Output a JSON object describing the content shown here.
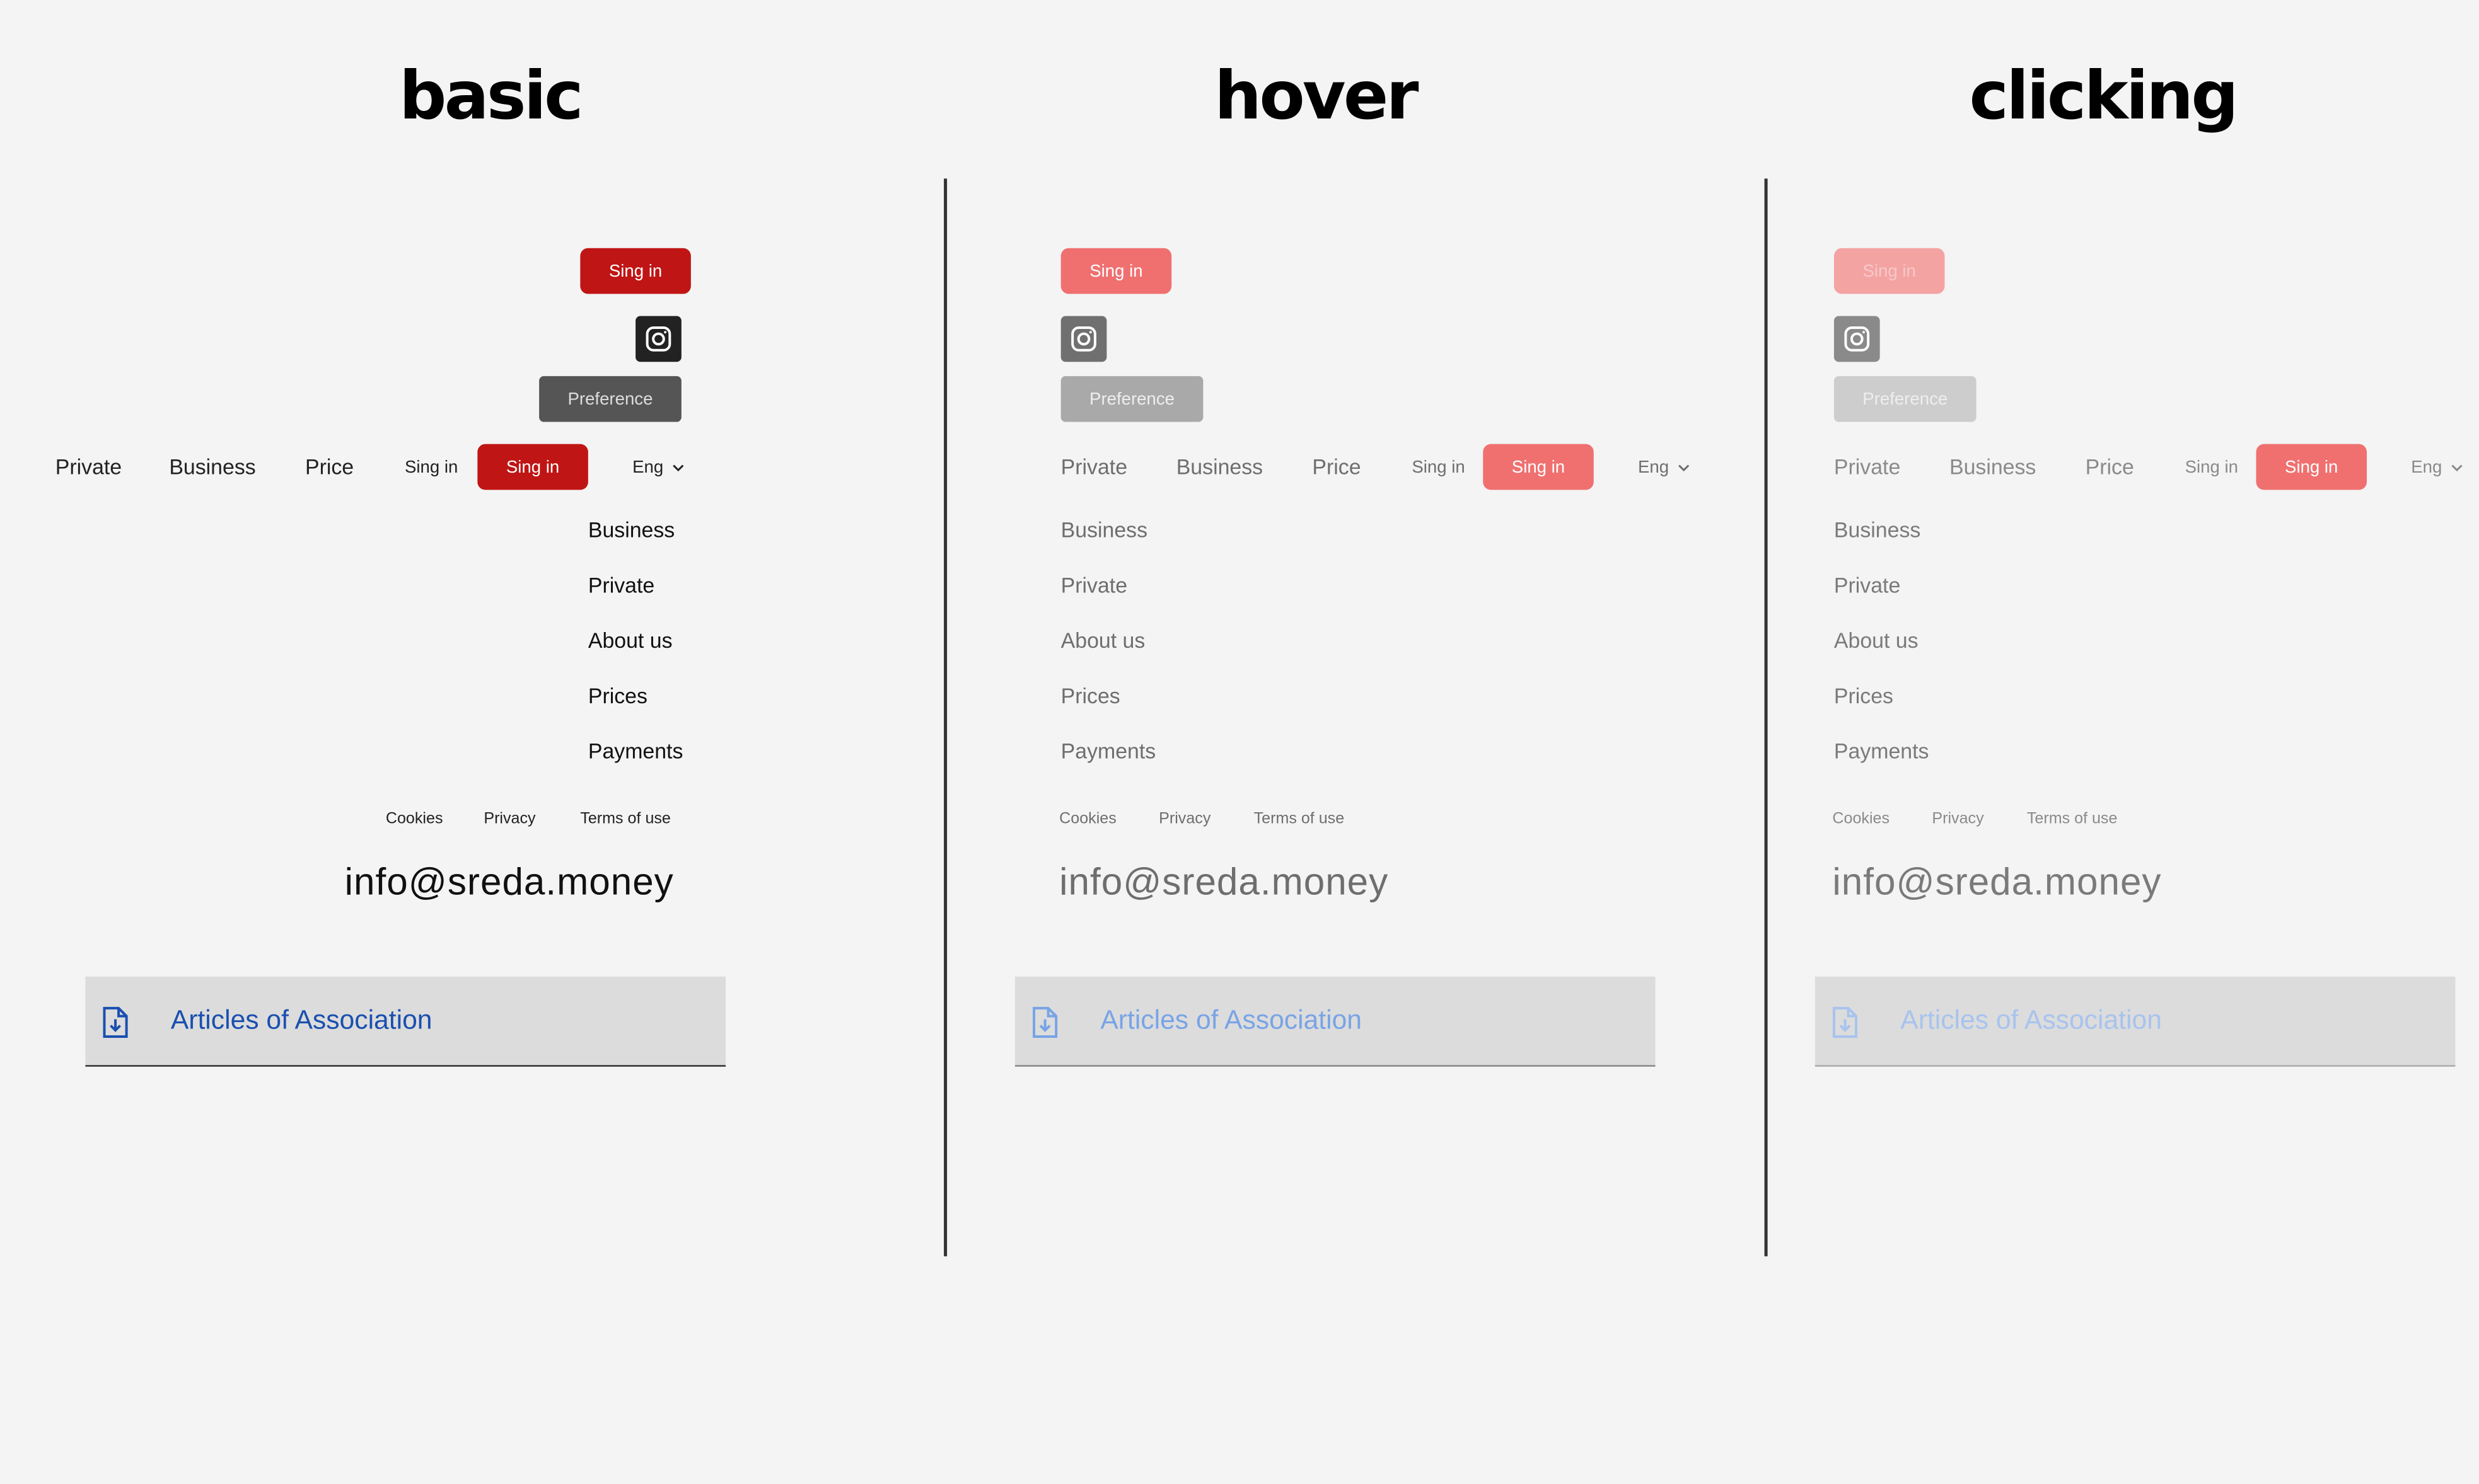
{
  "states": [
    {
      "title": "basic",
      "sign_in_button": "Sing in",
      "instagram_icon": "instagram-icon",
      "preference_button": "Preference",
      "nav": {
        "private": "Private",
        "business": "Business",
        "price": "Price",
        "sign_in_link": "Sing in",
        "sign_in_button": "Sing in",
        "lang": "Eng"
      },
      "menu": [
        "Business",
        "Private",
        "About us",
        "Prices",
        "Payments"
      ],
      "footer_links": [
        "Cookies",
        "Privacy",
        "Terms of use"
      ],
      "email": "info@sreda.money",
      "document": {
        "label": "Articles of Association",
        "icon": "file-download-icon"
      }
    },
    {
      "title": "hover",
      "sign_in_button": "Sing in",
      "instagram_icon": "instagram-icon",
      "preference_button": "Preference",
      "nav": {
        "private": "Private",
        "business": "Business",
        "price": "Price",
        "sign_in_link": "Sing in",
        "sign_in_button": "Sing in",
        "lang": "Eng"
      },
      "menu": [
        "Business",
        "Private",
        "About us",
        "Prices",
        "Payments"
      ],
      "footer_links": [
        "Cookies",
        "Privacy",
        "Terms of use"
      ],
      "email": "info@sreda.money",
      "document": {
        "label": "Articles of Association",
        "icon": "file-download-icon"
      }
    },
    {
      "title": "clicking",
      "sign_in_button": "Sing in",
      "instagram_icon": "instagram-icon",
      "preference_button": "Preference",
      "nav": {
        "private": "Private",
        "business": "Business",
        "price": "Price",
        "sign_in_link": "Sing in",
        "sign_in_button": "Sing in",
        "lang": "Eng"
      },
      "menu": [
        "Business",
        "Private",
        "About us",
        "Prices",
        "Payments"
      ],
      "footer_links": [
        "Cookies",
        "Privacy",
        "Terms of use"
      ],
      "email": "info@sreda.money",
      "document": {
        "label": "Articles of Association",
        "icon": "file-download-icon"
      }
    }
  ],
  "colors": {
    "background": "#f4f4f4",
    "basic_red": "#c01515",
    "basic_dark": "#222222",
    "basic_pref": "#555555",
    "basic_text": "#222222",
    "basic_link": "#1a4fb0",
    "hover_red": "#f07070",
    "hover_gray": "#707070",
    "hover_pref": "#a9a9a9",
    "hover_text": "#6e6e6e",
    "hover_link": "#78a4e6",
    "click_red": "#f4a3a3",
    "click_gray": "#8a8a8a",
    "click_pref": "#cdcdcd",
    "click_text": "#7a7a7a",
    "click_link": "#a8c3ee",
    "doc_bg": "#dcdcdc"
  }
}
